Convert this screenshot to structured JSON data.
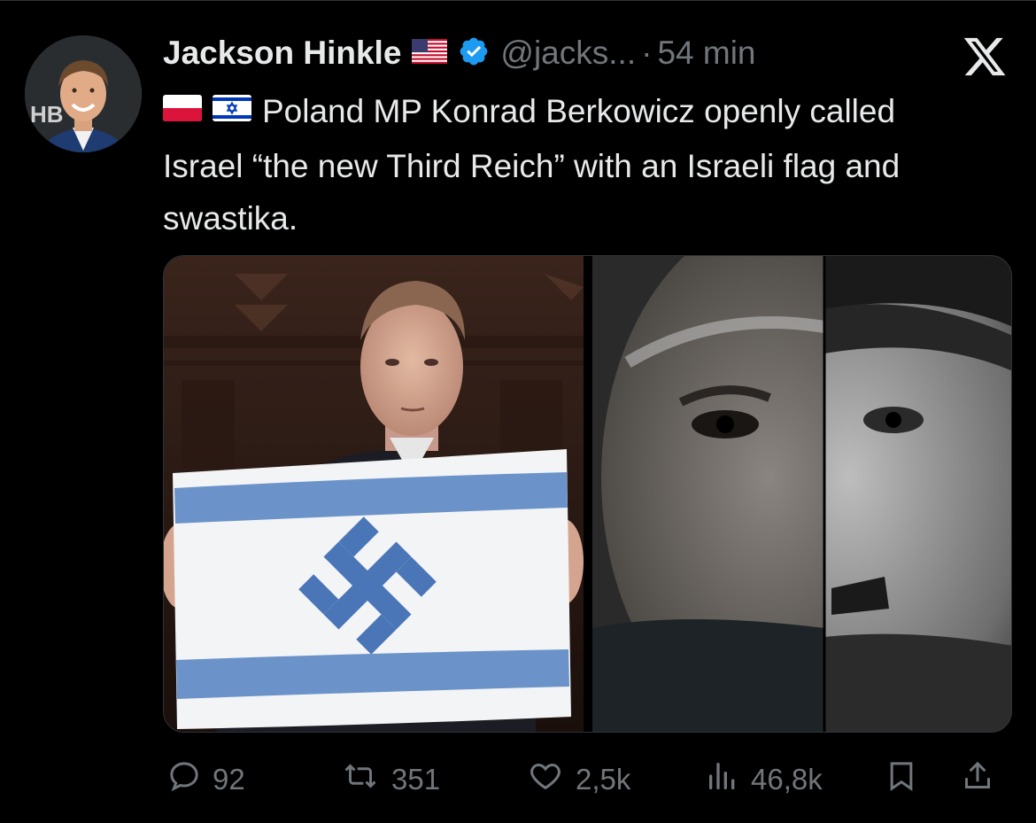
{
  "tweet": {
    "author_name": "Jackson Hinkle",
    "handle": "@jacks...",
    "separator": "·",
    "time": "54 min",
    "text": "Poland MP Konrad Berkowicz openly called Israel “the new Third Reich” with an Israeli flag and swastika.",
    "avatar_sign": "HB"
  },
  "actions": {
    "replies": "92",
    "retweets": "351",
    "likes": "2,5k",
    "views": "46,8k"
  },
  "icons": {
    "reply": "reply-icon",
    "retweet": "retweet-icon",
    "like": "heart-icon",
    "views": "views-icon",
    "bookmark": "bookmark-icon",
    "share": "share-icon",
    "verified": "verified-badge-icon",
    "logo": "x-logo-icon"
  },
  "colors": {
    "background": "#000000",
    "text": "#e7e9ea",
    "muted": "#71767b",
    "verified": "#1d9bf0"
  }
}
